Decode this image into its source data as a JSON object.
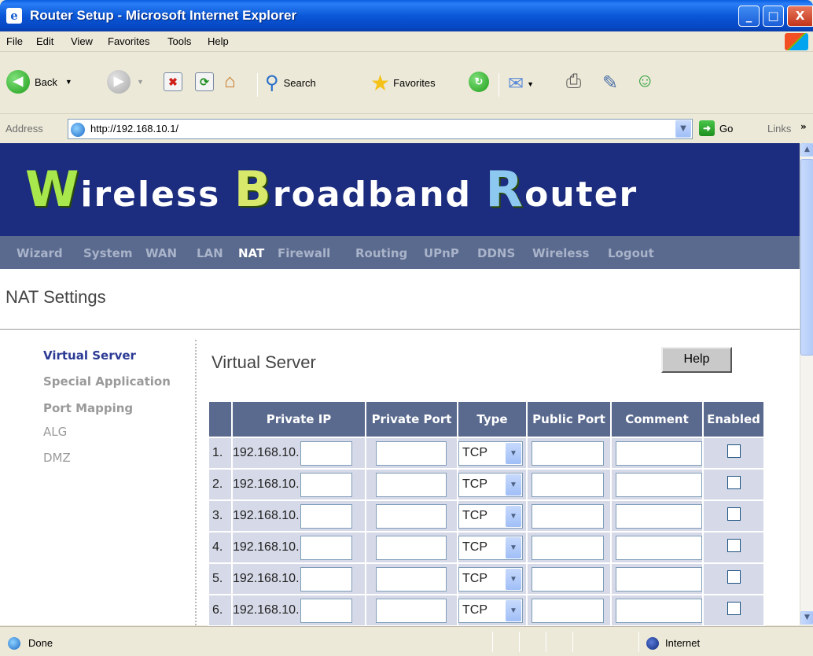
{
  "window": {
    "title": "Router Setup - Microsoft Internet Explorer",
    "controls": [
      "_",
      "□",
      "X"
    ]
  },
  "menu": [
    "File",
    "Edit",
    "View",
    "Favorites",
    "Tools",
    "Help"
  ],
  "toolbar": {
    "back_label": "Back",
    "search_label": "Search",
    "favorites_label": "Favorites"
  },
  "address": {
    "label": "Address",
    "url": "http://192.168.10.1/",
    "go_label": "Go",
    "links_label": "Links",
    "more_glyph": "»"
  },
  "banner": {
    "w": "W",
    "w_rest": "ireless ",
    "b": "B",
    "b_rest": "roadband ",
    "r": "R",
    "r_rest": "outer"
  },
  "nav": {
    "items": [
      "Wizard",
      "System",
      "WAN",
      "LAN",
      "NAT",
      "Firewall",
      "Routing",
      "UPnP",
      "DDNS",
      "Wireless",
      "Logout"
    ],
    "active": "NAT"
  },
  "page_title": "NAT Settings",
  "sidemenu": {
    "items": [
      "Virtual Server",
      "Special Application",
      "Port Mapping",
      "ALG",
      "DMZ"
    ],
    "active": "Virtual Server"
  },
  "section_title": "Virtual Server",
  "help_label": "Help",
  "table": {
    "headers": [
      "",
      "Private IP",
      "Private Port",
      "Type",
      "Public Port",
      "Comment",
      "Enabled"
    ],
    "ip_prefix": "192.168.10.",
    "rows": [
      {
        "num": "1.",
        "type": "TCP",
        "enabled": false
      },
      {
        "num": "2.",
        "type": "TCP",
        "enabled": false
      },
      {
        "num": "3.",
        "type": "TCP",
        "enabled": false
      },
      {
        "num": "4.",
        "type": "TCP",
        "enabled": false
      },
      {
        "num": "5.",
        "type": "TCP",
        "enabled": false
      },
      {
        "num": "6.",
        "type": "TCP",
        "enabled": false
      }
    ]
  },
  "status": {
    "text": "Done",
    "zone": "Internet"
  }
}
